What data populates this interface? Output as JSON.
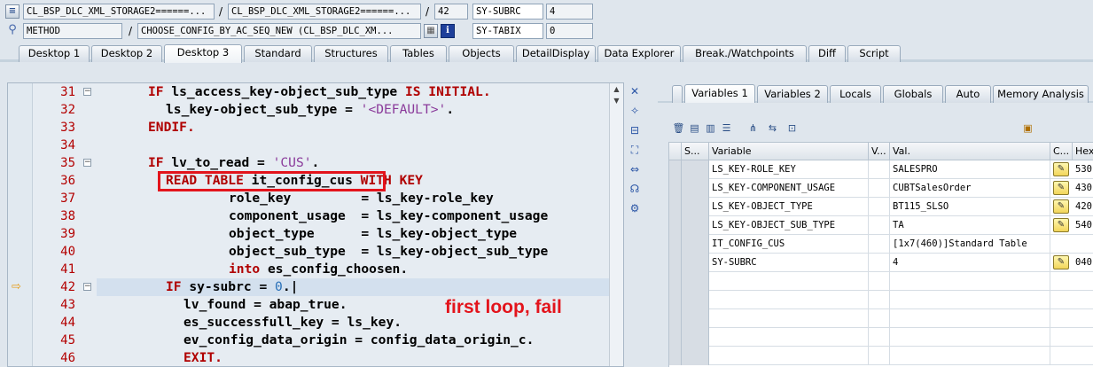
{
  "info": {
    "row1": {
      "program": "CL_BSP_DLC_XML_STORAGE2======...",
      "include": "CL_BSP_DLC_XML_STORAGE2======...",
      "line": "42",
      "sysvar": "SY-SUBRC",
      "sysval": "4"
    },
    "row2": {
      "event_type": "METHOD",
      "event": "CHOOSE_CONFIG_BY_AC_SEQ_NEW (CL_BSP_DLC_XM...",
      "sysvar": "SY-TABIX",
      "sysval": "0"
    },
    "separator": "/"
  },
  "desktop_tabs": [
    "Desktop 1",
    "Desktop 2",
    "Desktop 3",
    "Standard",
    "Structures",
    "Tables",
    "Objects",
    "DetailDisplay",
    "Data Explorer",
    "Break./Watchpoints",
    "Diff",
    "Script"
  ],
  "code": {
    "lines": [
      {
        "n": "31"
      },
      {
        "n": "32"
      },
      {
        "n": "33"
      },
      {
        "n": "34"
      },
      {
        "n": "35"
      },
      {
        "n": "36"
      },
      {
        "n": "37"
      },
      {
        "n": "38"
      },
      {
        "n": "39"
      },
      {
        "n": "40"
      },
      {
        "n": "41"
      },
      {
        "n": "42"
      },
      {
        "n": "43"
      },
      {
        "n": "44"
      },
      {
        "n": "45"
      },
      {
        "n": "46"
      }
    ],
    "t31a": "IF",
    "t31b": " ls_access_key-object_sub_type ",
    "t31c": "IS INITIAL",
    "t32a": "ls_key-object_sub_type = ",
    "t32b": "'<DEFAULT>'",
    "t33": "ENDIF",
    "t35a": "IF",
    "t35b": " lv_to_read = ",
    "t35c": "'CUS'",
    "t36a": "READ TABLE",
    "t36b": " it_config_cus ",
    "t36c": "WITH KEY",
    "t37": "role_key         = ls_key-role_key",
    "t38": "component_usage  = ls_key-component_usage",
    "t39": "object_type      = ls_key-object_type",
    "t40": "object_sub_type  = ls_key-object_sub_type",
    "t41a": "into",
    "t41b": " es_config_choosen",
    "t42a": "IF",
    "t42b": " sy-subrc = ",
    "t42c": "0",
    "t43a": "lv_found = abap_true",
    "t44a": "es_successfull_key = ls_key",
    "t45a": "ev_config_data_origin = config_data_origin_c",
    "t46a": "EXIT",
    "dot": "."
  },
  "annotation": "first loop, fail",
  "var_tabs": [
    "Variables 1",
    "Variables 2",
    "Locals",
    "Globals",
    "Auto",
    "Memory Analysis"
  ],
  "var_columns": [
    "S...",
    "Variable",
    "V...",
    "Val.",
    "C...",
    "Hex"
  ],
  "variables": [
    {
      "name": "LS_KEY-ROLE_KEY",
      "value": "SALESPRO",
      "hex": "530"
    },
    {
      "name": "LS_KEY-COMPONENT_USAGE",
      "value": "CUBTSalesOrder",
      "hex": "430"
    },
    {
      "name": "LS_KEY-OBJECT_TYPE",
      "value": "BT115_SLSO",
      "hex": "420"
    },
    {
      "name": "LS_KEY-OBJECT_SUB_TYPE",
      "value": "TA",
      "hex": "540"
    },
    {
      "name": "IT_CONFIG_CUS",
      "value": "[1x7(460)]Standard Table",
      "hex": ""
    },
    {
      "name": "SY-SUBRC",
      "value": "4",
      "hex": "040"
    }
  ],
  "colors": {
    "keyword": "#b00000",
    "string": "#8a3a9a",
    "number": "#2970b8",
    "annotation": "#e3141c",
    "line_number": "#b30000"
  }
}
